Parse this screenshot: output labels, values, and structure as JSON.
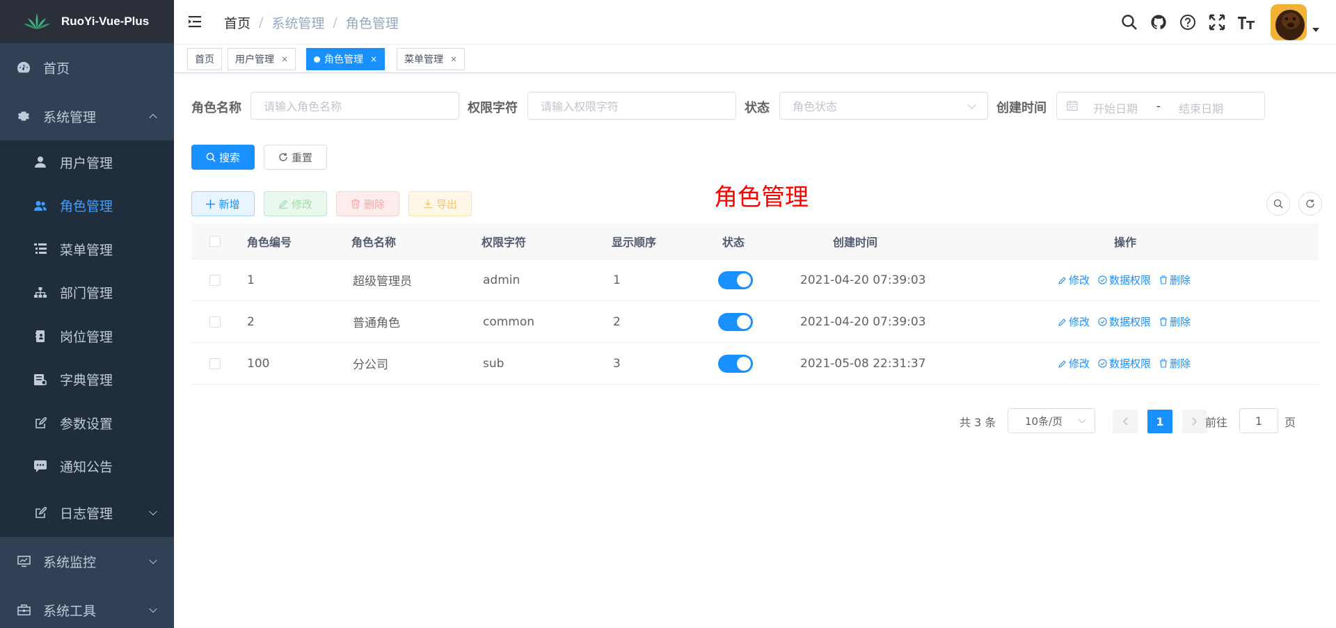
{
  "app": {
    "logo_text": "RuoYi-Vue-Plus"
  },
  "sidebar": {
    "home": "首页",
    "system": "系统管理",
    "sub_items": [
      "用户管理",
      "角色管理",
      "菜单管理",
      "部门管理",
      "岗位管理",
      "字典管理",
      "参数设置",
      "通知公告",
      "日志管理"
    ],
    "monitor": "系统监控",
    "tools": "系统工具"
  },
  "breadcrumb": {
    "home": "首页",
    "sep": "/",
    "level1": "系统管理",
    "level2": "角色管理"
  },
  "tags": [
    {
      "label": "首页",
      "close": ""
    },
    {
      "label": "用户管理",
      "close": "×"
    },
    {
      "label": "角色管理",
      "close": "×"
    },
    {
      "label": "菜单管理",
      "close": "×"
    }
  ],
  "search": {
    "role_name_label": "角色名称",
    "role_name_placeholder": "请输入角色名称",
    "role_key_label": "权限字符",
    "role_key_placeholder": "请输入权限字符",
    "status_label": "状态",
    "status_placeholder": "角色状态",
    "created_label": "创建时间",
    "start_placeholder": "开始日期",
    "range_sep": "-",
    "end_placeholder": "结束日期",
    "search_btn": "搜索",
    "reset_btn": "重置"
  },
  "toolbar": {
    "add": "新增",
    "edit": "修改",
    "delete": "删除",
    "export": "导出"
  },
  "overlay_title": "角色管理",
  "table": {
    "headers": {
      "id": "角色编号",
      "name": "角色名称",
      "key": "权限字符",
      "sort": "显示顺序",
      "status": "状态",
      "created": "创建时间",
      "ops": "操作"
    },
    "rows": [
      {
        "id": "1",
        "name": "超级管理员",
        "key": "admin",
        "sort": "1",
        "created": "2021-04-20 07:39:03",
        "status_on": true
      },
      {
        "id": "2",
        "name": "普通角色",
        "key": "common",
        "sort": "2",
        "created": "2021-04-20 07:39:03",
        "status_on": true
      },
      {
        "id": "100",
        "name": "分公司",
        "key": "sub",
        "sort": "3",
        "created": "2021-05-08 22:31:37",
        "status_on": true
      }
    ],
    "op_edit": "修改",
    "op_scope": "数据权限",
    "op_delete": "删除"
  },
  "pagination": {
    "total": "共 3 条",
    "page_size": "10条/页",
    "current": "1",
    "goto_prefix": "前往",
    "goto_value": "1",
    "goto_suffix": "页"
  },
  "colors": {
    "primary": "#1890ff",
    "sidebar_bg": "#304156",
    "submenu_bg": "#1f2d3d",
    "logo_bg": "#2b2f3a",
    "overlay_red": "#ff0000"
  }
}
